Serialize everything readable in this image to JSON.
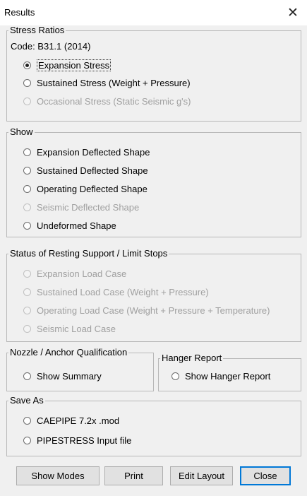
{
  "window": {
    "title": "Results",
    "close_glyph": "✕"
  },
  "stress_ratios": {
    "legend": "Stress Ratios",
    "code": "Code: B31.1 (2014)",
    "options": [
      {
        "label": "Expansion Stress",
        "checked": true,
        "disabled": false
      },
      {
        "label": "Sustained Stress (Weight + Pressure)",
        "checked": false,
        "disabled": false
      },
      {
        "label": "Occasional Stress (Static Seismic g's)",
        "checked": false,
        "disabled": true
      }
    ]
  },
  "show": {
    "legend": "Show",
    "options": [
      {
        "label": "Expansion Deflected Shape",
        "disabled": false
      },
      {
        "label": "Sustained Deflected Shape",
        "disabled": false
      },
      {
        "label": "Operating Deflected Shape",
        "disabled": false
      },
      {
        "label": "Seismic Deflected Shape",
        "disabled": true
      },
      {
        "label": "Undeformed Shape",
        "disabled": false
      }
    ]
  },
  "resting_support": {
    "legend": "Status of Resting Support / Limit Stops",
    "options": [
      {
        "label": "Expansion Load Case",
        "disabled": true
      },
      {
        "label": "Sustained Load Case (Weight + Pressure)",
        "disabled": true
      },
      {
        "label": "Operating Load Case (Weight + Pressure + Temperature)",
        "disabled": true
      },
      {
        "label": "Seismic Load Case",
        "disabled": true
      }
    ]
  },
  "nozzle": {
    "legend": "Nozzle / Anchor Qualification",
    "option": "Show Summary"
  },
  "hanger": {
    "legend": "Hanger Report",
    "option": "Show Hanger Report"
  },
  "save_as": {
    "legend": "Save As",
    "options": [
      "CAEPIPE 7.2x .mod",
      "PIPESTRESS Input file"
    ]
  },
  "buttons": {
    "show_modes": "Show Modes",
    "print": "Print",
    "edit_layout": "Edit Layout",
    "close": "Close"
  },
  "icons": {
    "radio": "radio-circle-icon",
    "close": "close-icon"
  }
}
